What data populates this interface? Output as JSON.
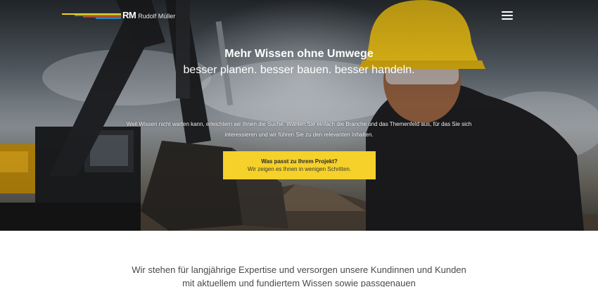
{
  "brand": {
    "mark": "RM",
    "name": "Rudolf Müller",
    "stripe_colors": [
      "#f5d12a",
      "#3aa64a",
      "#c0392b",
      "#2e86c1"
    ]
  },
  "header": {
    "menu_icon": "hamburger-menu-icon"
  },
  "hero": {
    "headline": "Mehr Wissen ohne Umwege",
    "subheadline": "besser planen. besser bauen. besser handeln.",
    "intro_line1": "Weil Wissen nicht warten kann, erleichtern wir Ihnen die Suche. Wählen Sie einfach die Branche und das Themenfeld aus, für das Sie sich",
    "intro_line2": "interessieren und wir führen Sie zu den relevanten Inhalten.",
    "cta": {
      "title": "Was passt zu Ihrem Projekt?",
      "subtitle": "Wir zeigen es Ihnen in wenigen Schritten.",
      "color": "#f5d12a"
    }
  },
  "main": {
    "statement_line1": "Wir stehen für langjährige Expertise und versorgen unsere Kundinnen und Kunden",
    "statement_line2": "mit aktuellem und fundiertem Wissen sowie passgenauen"
  }
}
